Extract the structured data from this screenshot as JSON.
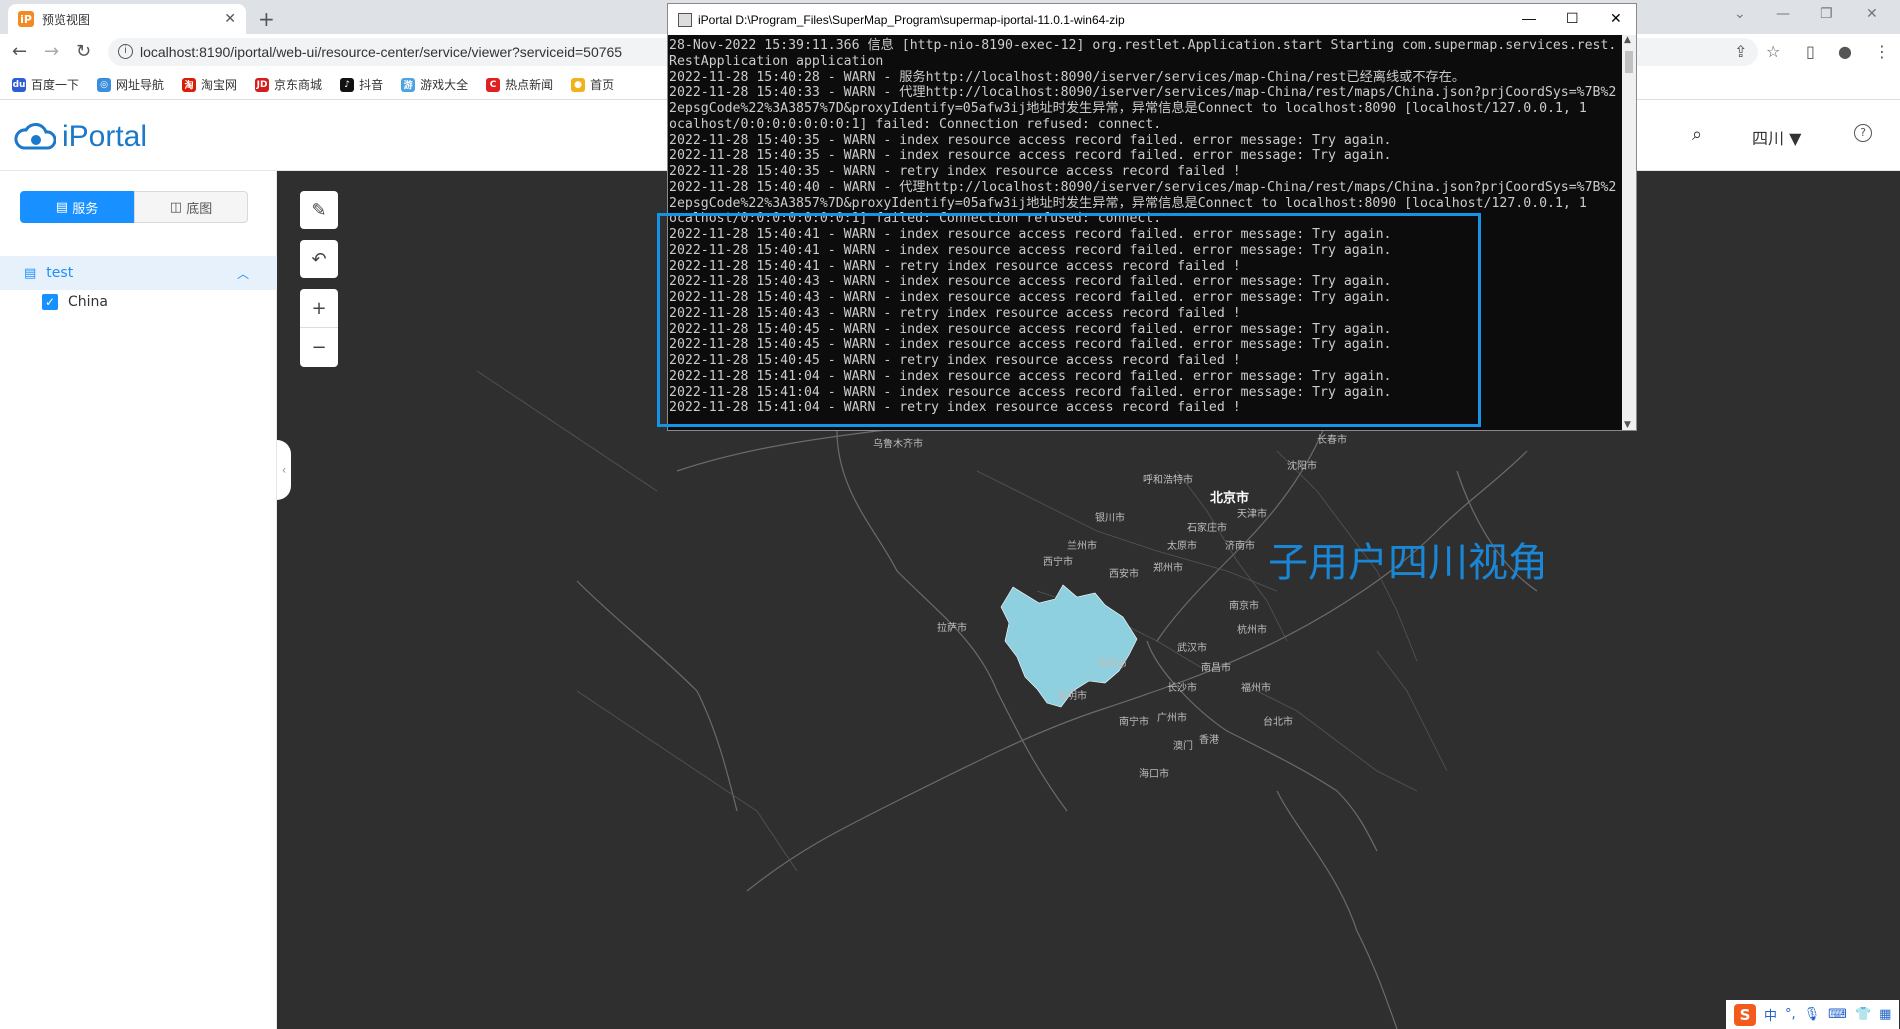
{
  "browser": {
    "tab_title": "预览视图",
    "tab_favicon": "iP",
    "new_tab": "+",
    "url": "localhost:8190/iportal/web-ui/resource-center/service/viewer?serviceid=50765",
    "bookmarks": [
      {
        "label": "百度一下",
        "color": "#2e5cd6",
        "icon": "du"
      },
      {
        "label": "网址导航",
        "color": "#3b8de0",
        "icon": "◎"
      },
      {
        "label": "淘宝网",
        "color": "#d81e06",
        "icon": "淘"
      },
      {
        "label": "京东商城",
        "color": "#d61c1c",
        "icon": "JD"
      },
      {
        "label": "抖音",
        "color": "#111111",
        "icon": "♪"
      },
      {
        "label": "游戏大全",
        "color": "#4ca3e0",
        "icon": "游"
      },
      {
        "label": "热点新闻",
        "color": "#e02020",
        "icon": "C"
      },
      {
        "label": "首页",
        "color": "#f2b21c",
        "icon": "●"
      }
    ]
  },
  "app": {
    "logo_text": "iPortal",
    "search_icon": "⌕",
    "user_label": "四川",
    "help_icon": "?"
  },
  "sidebar": {
    "tab_service": "服务",
    "tab_basemap": "底图",
    "group_label": "test",
    "layer_label": "China"
  },
  "map": {
    "annotation": "子用户四川视角",
    "highlight_color": "#8fd0e0",
    "cities": [
      {
        "name": "北京市",
        "big": true
      },
      {
        "name": "天津市"
      },
      {
        "name": "石家庄市"
      },
      {
        "name": "济南市"
      },
      {
        "name": "太原市"
      },
      {
        "name": "呼和浩特市"
      },
      {
        "name": "沈阳市"
      },
      {
        "name": "长春市"
      },
      {
        "name": "银川市"
      },
      {
        "name": "兰州市"
      },
      {
        "name": "西宁市"
      },
      {
        "name": "西安市"
      },
      {
        "name": "郑州市"
      },
      {
        "name": "南京市"
      },
      {
        "name": "杭州市"
      },
      {
        "name": "武汉市"
      },
      {
        "name": "南昌市"
      },
      {
        "name": "长沙市"
      },
      {
        "name": "福州市"
      },
      {
        "name": "台北市"
      },
      {
        "name": "广州市"
      },
      {
        "name": "香港"
      },
      {
        "name": "澳门"
      },
      {
        "name": "南宁市"
      },
      {
        "name": "海口市"
      },
      {
        "name": "昆明市"
      },
      {
        "name": "贵阳市"
      },
      {
        "name": "拉萨市"
      },
      {
        "name": "乌鲁木齐市"
      }
    ]
  },
  "console": {
    "title": "iPortal  D:\\Program_Files\\SuperMap_Program\\supermap-iportal-11.0.1-win64-zip",
    "lines": [
      "28-Nov-2022 15:39:11.366 信息 [http-nio-8190-exec-12] org.restlet.Application.start Starting com.supermap.services.rest.",
      "RestApplication application",
      "2022-11-28 15:40:28 - WARN - 服务http://localhost:8090/iserver/services/map-China/rest已经离线或不存在。",
      "2022-11-28 15:40:33 - WARN - 代理http://localhost:8090/iserver/services/map-China/rest/maps/China.json?prjCoordSys=%7B%2",
      "2epsgCode%22%3A3857%7D&proxyIdentify=05afw3ij地址时发生异常，异常信息是Connect to localhost:8090 [localhost/127.0.0.1, 1",
      "ocalhost/0:0:0:0:0:0:0:1] failed: Connection refused: connect.",
      "2022-11-28 15:40:35 - WARN - index resource access record failed. error message: Try again.",
      "2022-11-28 15:40:35 - WARN - index resource access record failed. error message: Try again.",
      "2022-11-28 15:40:35 - WARN - retry index resource access record failed !",
      "2022-11-28 15:40:40 - WARN - 代理http://localhost:8090/iserver/services/map-China/rest/maps/China.json?prjCoordSys=%7B%2",
      "2epsgCode%22%3A3857%7D&proxyIdentify=05afw3ij地址时发生异常，异常信息是Connect to localhost:8090 [localhost/127.0.0.1, 1",
      "ocalhost/0:0:0:0:0:0:0:1] failed: Connection refused: connect.",
      "2022-11-28 15:40:41 - WARN - index resource access record failed. error message: Try again.",
      "2022-11-28 15:40:41 - WARN - index resource access record failed. error message: Try again.",
      "2022-11-28 15:40:41 - WARN - retry index resource access record failed !",
      "2022-11-28 15:40:43 - WARN - index resource access record failed. error message: Try again.",
      "2022-11-28 15:40:43 - WARN - index resource access record failed. error message: Try again.",
      "2022-11-28 15:40:43 - WARN - retry index resource access record failed !",
      "2022-11-28 15:40:45 - WARN - index resource access record failed. error message: Try again.",
      "2022-11-28 15:40:45 - WARN - index resource access record failed. error message: Try again.",
      "2022-11-28 15:40:45 - WARN - retry index resource access record failed !",
      "2022-11-28 15:41:04 - WARN - index resource access record failed. error message: Try again.",
      "2022-11-28 15:41:04 - WARN - index resource access record failed. error message: Try again.",
      "2022-11-28 15:41:04 - WARN - retry index resource access record failed !"
    ]
  },
  "ime": {
    "logo": "S",
    "lang": "中"
  }
}
